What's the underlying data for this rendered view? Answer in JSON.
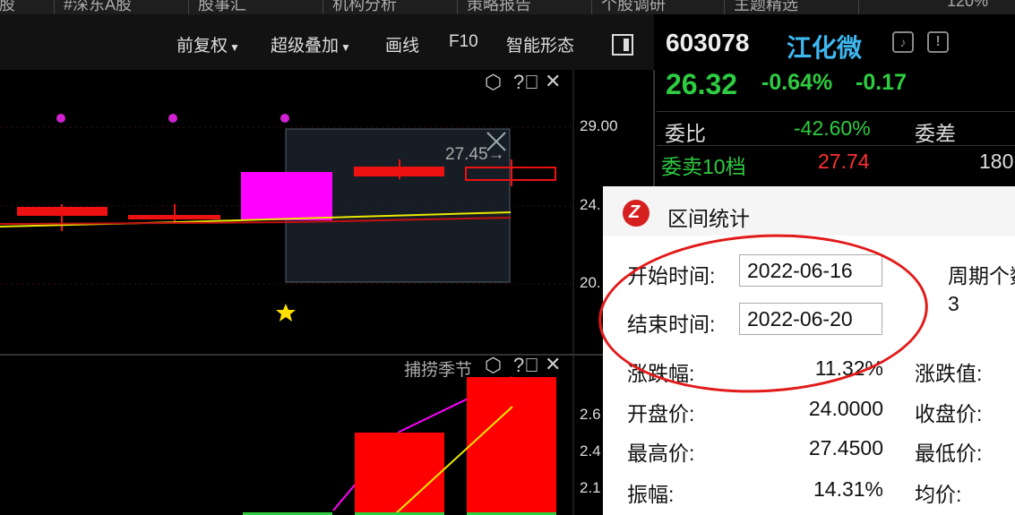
{
  "top_tabs": [
    "股",
    "#深东A股",
    "股事汇",
    "机构分析",
    "策略报告",
    "个股调研",
    "主题精选",
    "120%"
  ],
  "toolbar": {
    "fuquan": "前复权",
    "overlay": "超级叠加",
    "draw": "画线",
    "f10": "F10",
    "pattern": "智能形态"
  },
  "main_chart": {
    "price_labels": [
      "29.00",
      "24.",
      "20."
    ],
    "selection_label": "27.45→"
  },
  "sub_chart": {
    "title": "捕捞季节",
    "labels": [
      "2.6",
      "2.4",
      "2.1"
    ]
  },
  "colors": {
    "up": "#ff0000",
    "down": "#2ecc40",
    "magenta": "#ff00ff",
    "yellow": "#e8e800",
    "accent": "#3fb8f0"
  },
  "quote": {
    "code": "603078",
    "name": "江化微",
    "price": "26.32",
    "pct": "-0.64%",
    "change": "-0.17",
    "weibi_label": "委比",
    "weibi_value": "-42.60%",
    "weicha_label": "委差",
    "sell10_label": "委卖10档",
    "sell10_price": "27.74",
    "sell10_vol": "180"
  },
  "popup": {
    "title": "区间统计",
    "start_label": "开始时间:",
    "start_value": "2022-06-16",
    "end_label": "结束时间:",
    "end_value": "2022-06-20",
    "period_label": "周期个数",
    "period_value": "3",
    "left_rows": [
      {
        "label": "涨跌幅:",
        "value": "11.32%"
      },
      {
        "label": "开盘价:",
        "value": "24.0000"
      },
      {
        "label": "最高价:",
        "value": "27.4500"
      },
      {
        "label": "振幅:",
        "value": "14.31%"
      }
    ],
    "right_labels": [
      "涨跌值:",
      "收盘价:",
      "最低价:",
      "均价:"
    ]
  }
}
